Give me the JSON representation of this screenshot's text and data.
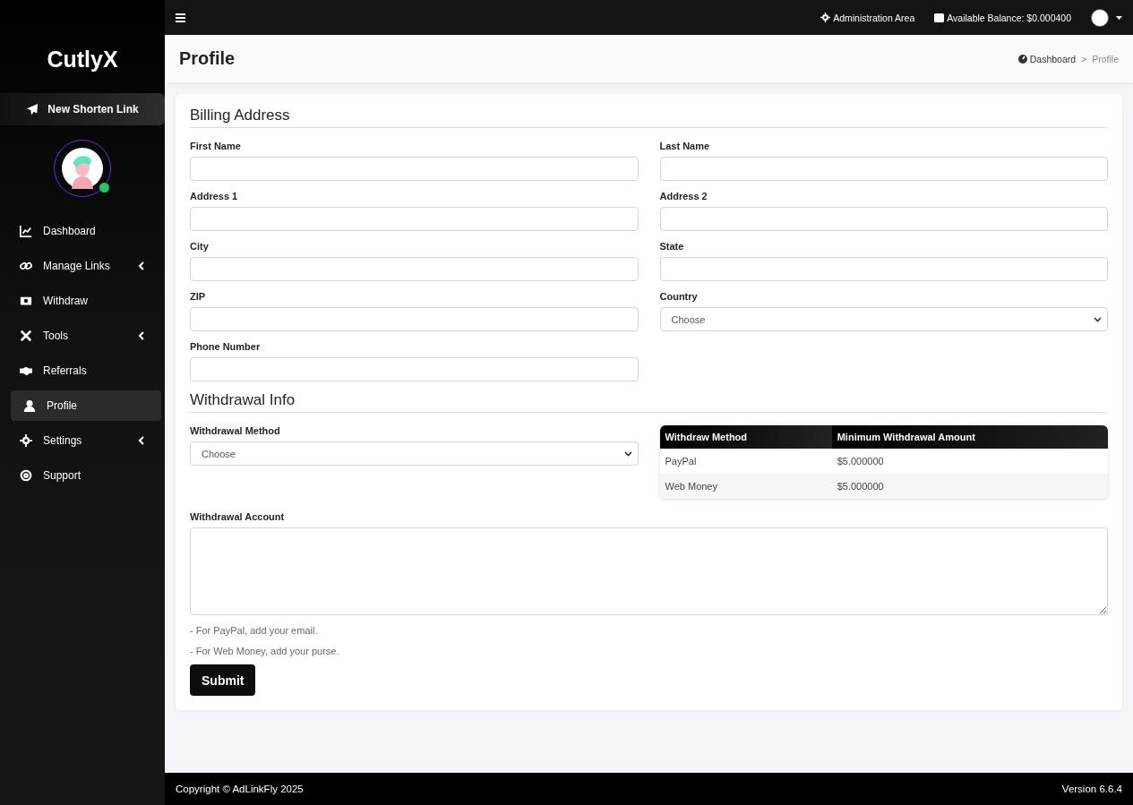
{
  "topbar": {
    "admin_link": "Administration Area",
    "balance": "Available Balance: $0.000400"
  },
  "sidebar": {
    "brand": "CutlyX",
    "new_link_button": "New Shorten Link",
    "user_online": true,
    "items": [
      {
        "label": "Dashboard",
        "expandable": false,
        "selected": false
      },
      {
        "label": "Manage Links",
        "expandable": true,
        "selected": false
      },
      {
        "label": "Withdraw",
        "expandable": false,
        "selected": false
      },
      {
        "label": "Tools",
        "expandable": true,
        "selected": false
      },
      {
        "label": "Referrals",
        "expandable": false,
        "selected": false
      },
      {
        "label": "Profile",
        "expandable": false,
        "selected": true
      },
      {
        "label": "Settings",
        "expandable": true,
        "selected": false
      },
      {
        "label": "Support",
        "expandable": false,
        "selected": false
      }
    ]
  },
  "page_header": {
    "title": "Profile",
    "breadcrumb": [
      "Dashboard",
      "Profile"
    ],
    "breadcrumb_separator": ">"
  },
  "billing": {
    "heading": "Billing Address",
    "fields": [
      {
        "label": "First Name",
        "kind": "text"
      },
      {
        "label": "Last Name",
        "kind": "text"
      },
      {
        "label": "Address 1",
        "kind": "text"
      },
      {
        "label": "Address 2",
        "kind": "text"
      },
      {
        "label": "City",
        "kind": "text"
      },
      {
        "label": "State",
        "kind": "text"
      },
      {
        "label": "ZIP",
        "kind": "text"
      },
      {
        "label": "Country",
        "kind": "select",
        "value": "Choose"
      },
      {
        "label": "Phone Number",
        "kind": "text"
      }
    ]
  },
  "withdrawal": {
    "heading": "Withdrawal Info",
    "method_label": "Withdrawal Method",
    "method_value": "Choose",
    "table": {
      "columns": [
        "Withdraw Method",
        "Minimum Withdrawal Amount"
      ],
      "rows": [
        [
          "PayPal",
          "$5.000000"
        ],
        [
          "Web Money",
          "$5.000000"
        ]
      ]
    },
    "account_label": "Withdrawal Account",
    "hints": [
      "- For PayPal, add your email.",
      "- For Web Money, add your purse."
    ],
    "submit": "Submit"
  },
  "footer": {
    "copyright": "Copyright © AdLinkFly 2025",
    "version": "Version 6.6.4"
  }
}
